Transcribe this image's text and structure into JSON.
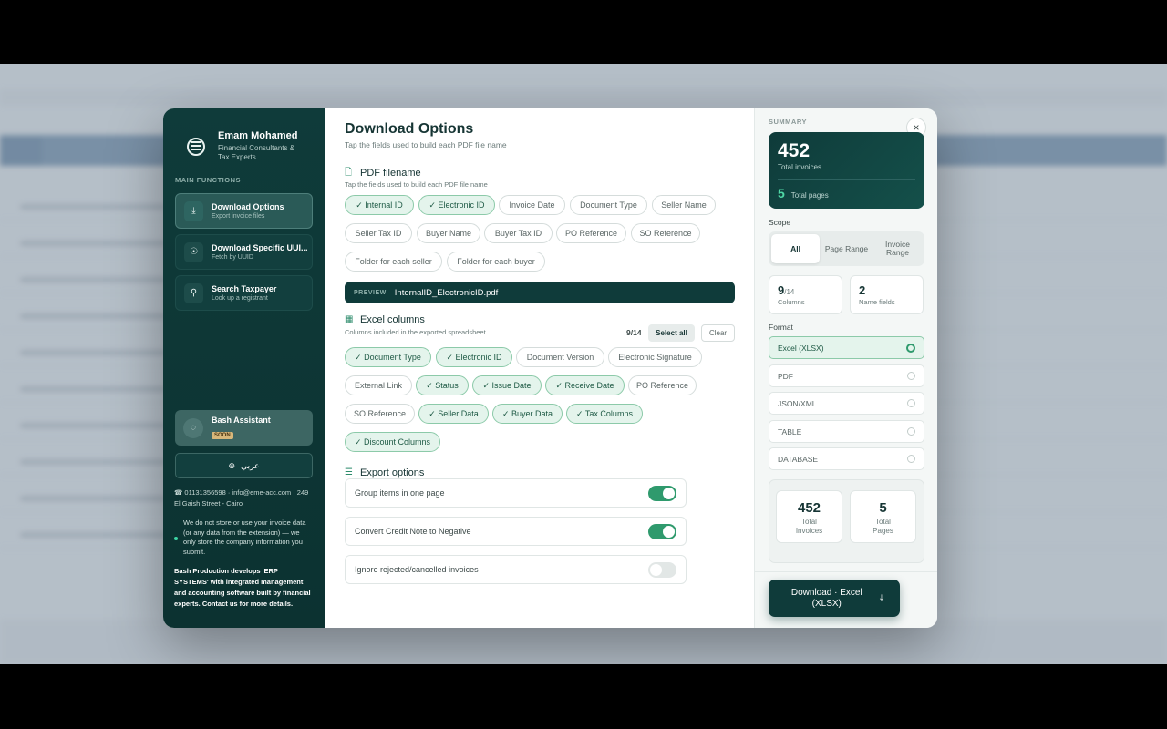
{
  "sidebar": {
    "brand_name": "Emam Mohamed",
    "brand_sub": "Financial Consultants & Tax Experts",
    "section_label": "MAIN FUNCTIONS",
    "items": [
      {
        "title": "Download Options",
        "sub": "Export invoice files",
        "icon": "download-icon"
      },
      {
        "title": "Download Specific UUI...",
        "sub": "Fetch by UUID",
        "icon": "fingerprint-icon"
      },
      {
        "title": "Search Taxpayer",
        "sub": "Look up a registrant",
        "icon": "user-search-icon"
      }
    ],
    "assistant": {
      "title": "Bash Assistant",
      "badge": "SOON"
    },
    "language": "عربي",
    "contact": "☎ 01131356598 · info@eme-acc.com · 249 El Gaish Street - Cairo",
    "notice": "We do not store or use your invoice data (or any data from the extension) — we only store the company information you submit.",
    "about": "Bash Production develops 'ERP SYSTEMS' with integrated management and accounting software built by financial experts. Contact us for more details."
  },
  "main": {
    "title": "Download Options",
    "subtitle": "Tap the fields used to build each PDF file name",
    "pdf": {
      "heading": "PDF filename",
      "sub": "Tap the fields used to build each PDF file name",
      "chips": [
        {
          "label": "✓ Internal ID",
          "on": true
        },
        {
          "label": "✓ Electronic ID",
          "on": true
        },
        {
          "label": "Invoice Date",
          "on": false
        },
        {
          "label": "Document Type",
          "on": false
        },
        {
          "label": "Seller Name",
          "on": false
        },
        {
          "label": "Seller Tax ID",
          "on": false
        },
        {
          "label": "Buyer Name",
          "on": false
        },
        {
          "label": "Buyer Tax ID",
          "on": false
        },
        {
          "label": "PO Reference",
          "on": false
        },
        {
          "label": "SO Reference",
          "on": false
        },
        {
          "label": "Folder for each seller",
          "on": false
        },
        {
          "label": "Folder for each buyer",
          "on": false
        }
      ],
      "preview_label": "PREVIEW",
      "preview_value": "InternalID_ElectronicID.pdf"
    },
    "excel": {
      "heading": "Excel columns",
      "sub": "Columns included in the exported spreadsheet",
      "count": "9/14",
      "select_all": "Select all",
      "clear": "Clear",
      "chips": [
        {
          "label": "✓ Document Type",
          "on": true
        },
        {
          "label": "✓ Electronic ID",
          "on": true
        },
        {
          "label": "Document Version",
          "on": false
        },
        {
          "label": "Electronic Signature",
          "on": false
        },
        {
          "label": "External Link",
          "on": false
        },
        {
          "label": "✓ Status",
          "on": true
        },
        {
          "label": "✓ Issue Date",
          "on": true
        },
        {
          "label": "✓ Receive Date",
          "on": true
        },
        {
          "label": "PO Reference",
          "on": false
        },
        {
          "label": "SO Reference",
          "on": false
        },
        {
          "label": "✓ Seller Data",
          "on": true
        },
        {
          "label": "✓ Buyer Data",
          "on": true
        },
        {
          "label": "✓ Tax Columns",
          "on": true
        },
        {
          "label": "✓ Discount Columns",
          "on": true
        }
      ]
    },
    "export": {
      "heading": "Export options",
      "options": [
        {
          "label": "Group items in one page",
          "on": true
        },
        {
          "label": "Convert Credit Note to Negative",
          "on": true
        },
        {
          "label": "Ignore rejected/cancelled invoices",
          "on": false
        }
      ]
    }
  },
  "summary": {
    "label": "SUMMARY",
    "total_invoices": "452",
    "total_invoices_label": "Total invoices",
    "total_pages": "5",
    "total_pages_label": "Total pages",
    "scope_label": "Scope",
    "scope_options": [
      "All",
      "Page Range",
      "Invoice Range"
    ],
    "columns_value": "9",
    "columns_of": "/14",
    "columns_label": "Columns",
    "name_fields_value": "2",
    "name_fields_label": "Name fields",
    "format_label": "Format",
    "formats": [
      {
        "label": "Excel (XLSX)",
        "selected": true
      },
      {
        "label": "PDF",
        "selected": false
      },
      {
        "label": "JSON/XML",
        "selected": false
      },
      {
        "label": "TABLE",
        "selected": false
      },
      {
        "label": "DATABASE",
        "selected": false
      }
    ],
    "totals": [
      {
        "value": "452",
        "label": "Total Invoices"
      },
      {
        "value": "5",
        "label": "Total Pages"
      }
    ],
    "download_label": "Download · Excel (XLSX)",
    "close": "×"
  }
}
